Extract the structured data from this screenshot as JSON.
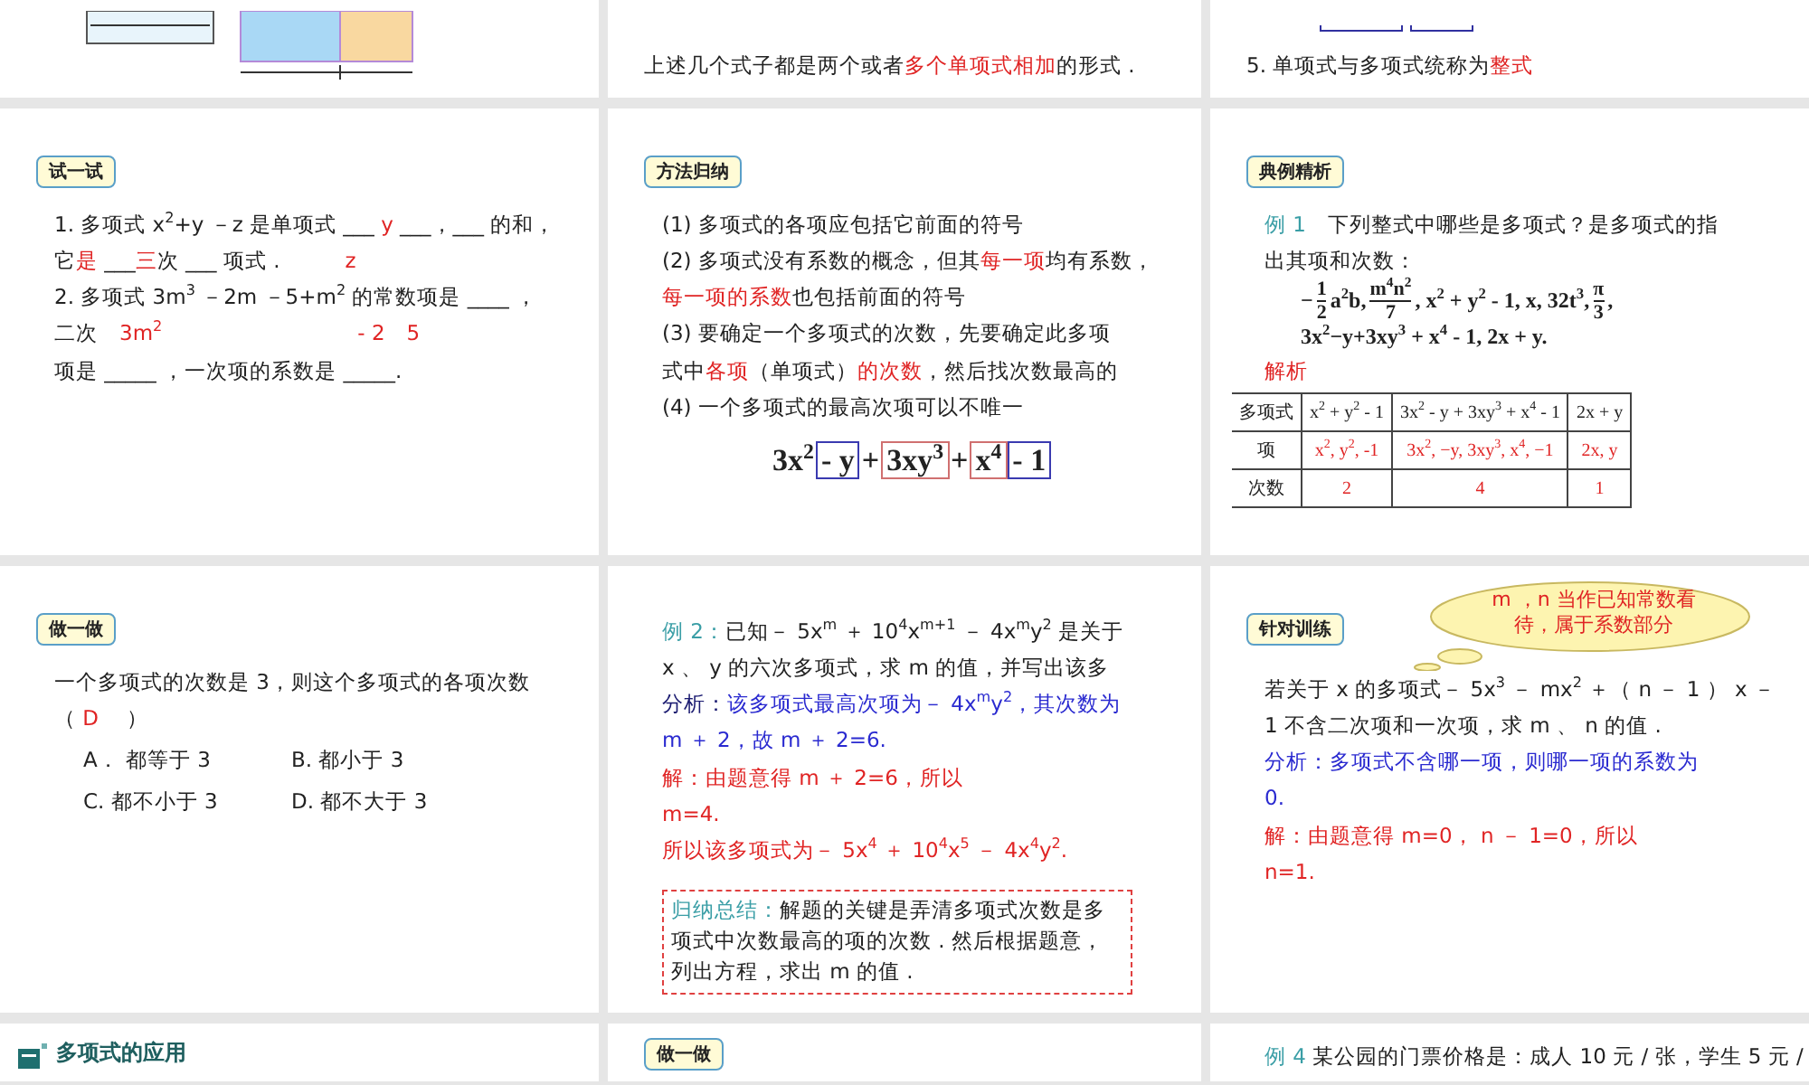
{
  "slides": [
    {
      "kind": "diagram"
    },
    {
      "kind": "lesson",
      "blocks": [
        {
          "kind": "line",
          "parts": [
            {
              "text": "上述几个式子都是两个或者",
              "color": "#222222"
            },
            {
              "text": "多个单项式相加",
              "color": "#e02424"
            },
            {
              "text": "的形式 .",
              "color": "#222222"
            }
          ]
        }
      ]
    },
    {
      "kind": "lesson",
      "blocks": [
        {
          "kind": "boxes"
        },
        {
          "kind": "line",
          "parts": [
            {
              "text": "5. 单项式与多项式统称为",
              "color": "#222222"
            },
            {
              "text": "整式",
              "color": "#e02424"
            }
          ]
        }
      ]
    },
    {
      "kind": "lesson",
      "badge": "试一试",
      "blocks": [
        {
          "kind": "line",
          "parts": [
            {
              "text": "1. 多项式 x$^{2}$+y －z 是单项式 ___ ",
              "color": "#222222"
            },
            {
              "text": "y",
              "color": "#e02424"
            },
            {
              "text": " ___，___ 的和，",
              "color": "#222222"
            }
          ]
        },
        {
          "kind": "line",
          "parts": [
            {
              "text": "它",
              "color": "#222222"
            },
            {
              "text": "是",
              "color": "#e02424"
            },
            {
              "text": " ___",
              "color": "#222222"
            },
            {
              "text": "三",
              "color": "#e02424"
            },
            {
              "text": "次 ___ 项式 .",
              "color": "#222222"
            },
            {
              "text": "　　　z",
              "color": "#e02424"
            }
          ]
        },
        {
          "kind": "line",
          "parts": [
            {
              "text": "2. 多项式 3m$^{3}$ －2m －5+m$^{2}$ 的常数项是 ____ ，",
              "color": "#222222"
            }
          ]
        },
        {
          "kind": "line",
          "parts": [
            {
              "text": "二次　",
              "color": "#222222"
            },
            {
              "text": "3m$^{2}$　　　　　　　　　- 2　5",
              "color": "#e02424"
            }
          ]
        },
        {
          "kind": "line",
          "parts": [
            {
              "text": "项是 _____ ，一次项的系数是 _____.",
              "color": "#222222"
            }
          ]
        }
      ]
    },
    {
      "kind": "lesson",
      "badge": "方法归纳",
      "blocks": [
        {
          "kind": "line",
          "parts": [
            {
              "text": "(1) 多项式的各项应包括它前面的符号",
              "color": "#222222"
            }
          ]
        },
        {
          "kind": "line",
          "parts": [
            {
              "text": "(2) 多项式没有系数的概念，但其",
              "color": "#222222"
            },
            {
              "text": "每一项",
              "color": "#e02424"
            },
            {
              "text": "均有系数，",
              "color": "#222222"
            }
          ]
        },
        {
          "kind": "line",
          "parts": [
            {
              "text": "每一项的系数",
              "color": "#e02424"
            },
            {
              "text": "也包括前面的符号",
              "color": "#222222"
            }
          ]
        },
        {
          "kind": "line",
          "parts": [
            {
              "text": "(3) 要确定一个多项式的次数，先要确定此多项",
              "color": "#222222"
            }
          ]
        },
        {
          "kind": "line",
          "parts": [
            {
              "text": "式中",
              "color": "#222222"
            },
            {
              "text": "各项",
              "color": "#e02424"
            },
            {
              "text": "（单项式）",
              "color": "#222222"
            },
            {
              "text": "的次数",
              "color": "#e02424"
            },
            {
              "text": "，然后找次数最高的",
              "color": "#222222"
            }
          ]
        },
        {
          "kind": "line",
          "parts": [
            {
              "text": "(4) 一个多项式的最高次项可以不唯一",
              "color": "#222222"
            }
          ]
        },
        {
          "kind": "formula",
          "parts": [
            {
              "text": "3x$^{2}$",
              "boxed": false
            },
            {
              "text": "- y",
              "boxed": true,
              "color": "#3a3ab0"
            },
            {
              "text": "+",
              "boxed": false
            },
            {
              "text": "3xy$^{3}$",
              "boxed": true,
              "color": "#d07070"
            },
            {
              "text": "+",
              "boxed": false
            },
            {
              "text": "x$^{4}$",
              "boxed": true,
              "color": "#d07070"
            },
            {
              "text": "- 1",
              "boxed": true,
              "color": "#3a3ab0"
            }
          ]
        }
      ]
    },
    {
      "kind": "lesson",
      "badge": "典例精析",
      "blocks": [
        {
          "kind": "line",
          "parts": [
            {
              "text": "例 1　",
              "color": "#3a9ea6"
            },
            {
              "text": "下列整式中哪些是多项式？是多项式的指",
              "color": "#222222"
            }
          ]
        },
        {
          "kind": "line",
          "parts": [
            {
              "text": "出其项和次数：",
              "color": "#222222"
            }
          ]
        },
        {
          "kind": "math",
          "parts": [
            {
              "kind": "text",
              "text": "−"
            },
            {
              "kind": "frac",
              "num": "1",
              "den": "2"
            },
            {
              "kind": "text",
              "text": "a$^{2}$b, "
            },
            {
              "kind": "frac",
              "num": "m$^{4}$n$^{2}$",
              "den": "7"
            },
            {
              "kind": "text",
              "text": ", x$^{2}$ + y$^{2}$ - 1, x, 32t$^{3}$, "
            },
            {
              "kind": "frac",
              "num": "π",
              "den": "3"
            },
            {
              "kind": "text",
              "text": ","
            }
          ]
        },
        {
          "kind": "math",
          "parts": [
            {
              "kind": "text",
              "text": "3x$^{2}$−y+3xy$^{3}$ + x$^{4}$ - 1, 2x + y."
            }
          ]
        },
        {
          "kind": "line",
          "parts": [
            {
              "text": "解析",
              "color": "#e02424"
            }
          ]
        },
        {
          "kind": "table",
          "rows": [
            {
              "cells": [
                {
                  "text": "多项式",
                  "color": "#222222"
                },
                {
                  "text": "x$^{2}$ + y$^{2}$ - 1",
                  "color": "#222222"
                },
                {
                  "text": "3x$^{2}$ - y + 3xy$^{3}$ + x$^{4}$ - 1",
                  "color": "#222222"
                },
                {
                  "text": "2x + y",
                  "color": "#222222"
                }
              ]
            },
            {
              "cells": [
                {
                  "text": "项",
                  "color": "#222222"
                },
                {
                  "text": "x$^{2}$, y$^{2}$, -1",
                  "color": "#e02424"
                },
                {
                  "text": "3x$^{2}$, −y, 3xy$^{3}$, x$^{4}$, −1",
                  "color": "#e02424"
                },
                {
                  "text": "2x, y",
                  "color": "#e02424"
                }
              ]
            },
            {
              "cells": [
                {
                  "text": "次数",
                  "color": "#222222"
                },
                {
                  "text": "2",
                  "color": "#e02424"
                },
                {
                  "text": "4",
                  "color": "#e02424"
                },
                {
                  "text": "1",
                  "color": "#e02424"
                }
              ]
            }
          ]
        }
      ]
    },
    {
      "kind": "lesson",
      "badge": "做一做",
      "blocks": [
        {
          "kind": "line",
          "parts": [
            {
              "text": "一个多项式的次数是 3，则这个多项式的各项次数",
              "color": "#222222"
            }
          ]
        },
        {
          "kind": "line",
          "parts": [
            {
              "text": "（ ",
              "color": "#222222"
            },
            {
              "text": "D",
              "color": "#e02424"
            },
            {
              "text": "　 ）",
              "color": "#222222"
            }
          ]
        },
        {
          "kind": "options",
          "items": [
            "A． 都等于 3",
            "B. 都小于 3",
            "C. 都不小于 3",
            "D. 都不大于 3"
          ]
        }
      ]
    },
    {
      "kind": "lesson",
      "blocks": [
        {
          "kind": "line",
          "parts": [
            {
              "text": "例 2：",
              "color": "#3a9ea6"
            },
            {
              "text": "已知－ 5x$^{m}$ ＋ 10$^{4}$x$^{m+1}$ － 4x$^{m}$y$^{2}$ 是关于",
              "color": "#222222"
            }
          ]
        },
        {
          "kind": "line",
          "parts": [
            {
              "text": "x 、 y 的六次多项式，求 m 的值，并写出该多",
              "color": "#222222"
            }
          ]
        },
        {
          "kind": "line",
          "parts": [
            {
              "text": "分析：",
              "color": "#1a1a70"
            },
            {
              "text": "该多项式最高次项为－ 4x$^{m}$y$^{2}$，其次数为",
              "color": "#2a2ad0"
            }
          ]
        },
        {
          "kind": "line",
          "parts": [
            {
              "text": "m ＋ 2，故 m ＋ 2=6.",
              "color": "#2a2ad0"
            }
          ]
        },
        {
          "kind": "line",
          "parts": [
            {
              "text": "解：由题意得 m ＋ 2=6，所以",
              "color": "#e02424"
            }
          ]
        },
        {
          "kind": "line",
          "parts": [
            {
              "text": "m=4.",
              "color": "#e02424"
            }
          ]
        },
        {
          "kind": "line",
          "parts": [
            {
              "text": "所以该多项式为－ 5x$^{4}$ ＋ 10$^{4}$x$^{5}$ － 4x$^{4}$y$^{2}$.",
              "color": "#e02424"
            }
          ]
        },
        {
          "kind": "summary",
          "parts": [
            {
              "text": "归纳总结：",
              "color": "#3a9ea6"
            },
            {
              "text": "解题的关键是弄清多项式次数是多项式中次数最高的项的次数 . 然后根据题意，列出方程，求出 m 的值 .",
              "color": "#222222"
            }
          ]
        }
      ]
    },
    {
      "kind": "lesson",
      "badge": "针对训练",
      "blocks": [
        {
          "kind": "callout",
          "text": "m ，n 当作已知常数看待，属于系数部分"
        },
        {
          "kind": "line",
          "parts": [
            {
              "text": "若关于 x 的多项式－ 5x$^{3}$ － mx$^{2}$ ＋（ n － 1 ） x －",
              "color": "#222222"
            }
          ]
        },
        {
          "kind": "line",
          "parts": [
            {
              "text": "1 不含二次项和一次项，求 m 、 n 的值 .",
              "color": "#222222"
            }
          ]
        },
        {
          "kind": "line",
          "parts": [
            {
              "text": "分析：多项式不含哪一项，则哪一项的系数为",
              "color": "#2a2ad0"
            }
          ]
        },
        {
          "kind": "line",
          "parts": [
            {
              "text": "0.",
              "color": "#2a2ad0"
            }
          ]
        },
        {
          "kind": "line",
          "parts": [
            {
              "text": "解：由题意得 m=0， n － 1=0，所以",
              "color": "#e02424"
            }
          ]
        },
        {
          "kind": "line",
          "parts": [
            {
              "text": "n=1.",
              "color": "#e02424"
            }
          ]
        }
      ]
    },
    {
      "kind": "lesson",
      "blocks": [
        {
          "kind": "heading",
          "text": "多项式的应用"
        }
      ]
    },
    {
      "kind": "lesson",
      "badge": "做一做"
    },
    {
      "kind": "lesson",
      "blocks": [
        {
          "kind": "line",
          "parts": [
            {
              "text": "例 4 ",
              "color": "#3a9ea6"
            },
            {
              "text": "某公园的门票价格是：成人 10 元 / 张，学生 5 元 /",
              "color": "#222222"
            }
          ]
        }
      ]
    }
  ]
}
